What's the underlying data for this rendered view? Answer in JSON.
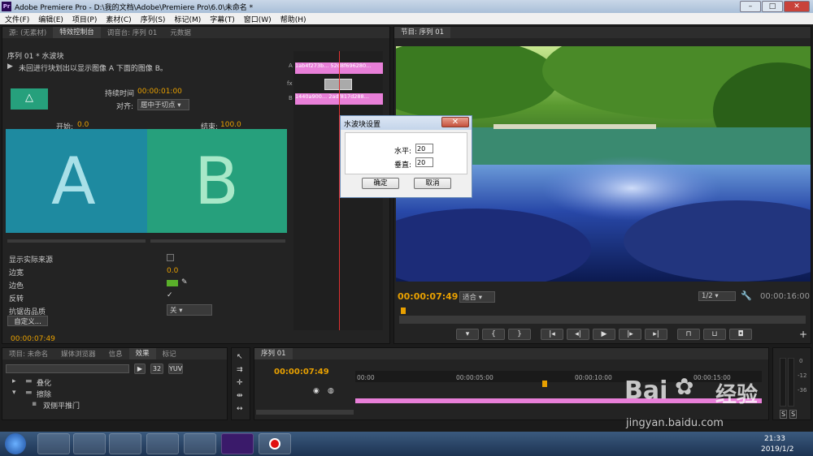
{
  "window": {
    "title": "Adobe Premiere Pro - D:\\我的文档\\Adobe\\Premiere Pro\\6.0\\未命名 *",
    "logo": "Pr"
  },
  "menu": [
    "文件(F)",
    "编辑(E)",
    "项目(P)",
    "素材(C)",
    "序列(S)",
    "标记(M)",
    "字幕(T)",
    "窗口(W)",
    "帮助(H)"
  ],
  "top_left_tabs": [
    "源: (无素材)",
    "特效控制台",
    "调音台: 序列 01",
    "元数据"
  ],
  "effect_controls": {
    "header": "序列 01 * 水波块",
    "desc": "未回进行块划出以显示图像 A 下面的图像 B。",
    "duration_label": "持续时间",
    "duration_value": "00:00:01:00",
    "align_label": "对齐:",
    "align_value": "居中于切点",
    "start_label": "开始:",
    "start_value": "0.0",
    "end_label": "结束:",
    "end_value": "100.0",
    "preview_a": "A",
    "preview_b": "B",
    "props": [
      {
        "label": "显示实际来源"
      },
      {
        "label": "边宽",
        "value": "0.0"
      },
      {
        "label": "边色"
      },
      {
        "label": "反转"
      },
      {
        "label": "抗锯齿品质",
        "value": "关"
      }
    ],
    "custom_button": "自定义...",
    "timecode": "00:00:07:49",
    "clip_a": "1ab4f273b...",
    "clip_a2": "52d8f696280...",
    "clip_b": "1440a900...",
    "clip_b2": "2adf817d288...",
    "track_a": "A",
    "track_b": "B",
    "fx": "fx"
  },
  "dialog": {
    "title": "水波块设置",
    "close": "✕",
    "horizontal_label": "水平:",
    "horizontal_value": "20",
    "vertical_label": "垂直:",
    "vertical_value": "20",
    "ok": "确定",
    "cancel": "取消"
  },
  "program": {
    "tab": "节目: 序列 01",
    "timecode": "00:00:07:49",
    "fit": "适合",
    "quality": "1/2",
    "duration": "00:00:16:00"
  },
  "project_tabs": [
    "项目: 未命名",
    "媒体浏览器",
    "信息",
    "效果",
    "标记"
  ],
  "effects_list": [
    "叠化",
    "擦除",
    "双侧平推门"
  ],
  "effects_icons": [
    "32",
    "YUV"
  ],
  "timeline": {
    "tab": "序列 01",
    "timecode": "00:00:07:49",
    "ticks": [
      "00:00",
      "00:00:05:00",
      "00:00:10:00",
      "00:00:15:00"
    ]
  },
  "meter": {
    "labels": [
      "0",
      "-12",
      "-36"
    ],
    "solo": [
      "S",
      "S"
    ]
  },
  "tray": {
    "time": "21:33",
    "date": "2019/1/2"
  },
  "watermark": {
    "brand": "Bai",
    "brand2": "经验",
    "url": "jingyan.baidu.com"
  },
  "colors": {
    "accent": "#e8a000",
    "teal_a": "#1e8aa0",
    "teal_b": "#26a07c",
    "pink_clip": "#e87fd8"
  }
}
